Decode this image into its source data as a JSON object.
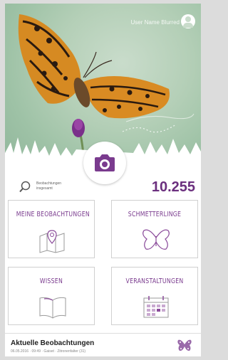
{
  "header": {
    "username": "User Name Blurred"
  },
  "stats": {
    "label": "Beobachtungen insgesamt",
    "value": "10.255"
  },
  "tiles": [
    {
      "label": "MEINE BEOBACHTUNGEN",
      "icon": "map-pin-icon"
    },
    {
      "label": "SCHMETTERLINGE",
      "icon": "butterfly-icon"
    },
    {
      "label": "WISSEN",
      "icon": "book-icon"
    },
    {
      "label": "VERANSTALTUNGEN",
      "icon": "calendar-icon"
    }
  ],
  "footer": {
    "title": "Aktuelle Beobachtungen",
    "subtitle": "06.05.2016 · 09:49 · Gaiset · Zitronenfalter (31)"
  },
  "colors": {
    "accent": "#6b2f7e",
    "background_green": "#b4cfb7"
  }
}
